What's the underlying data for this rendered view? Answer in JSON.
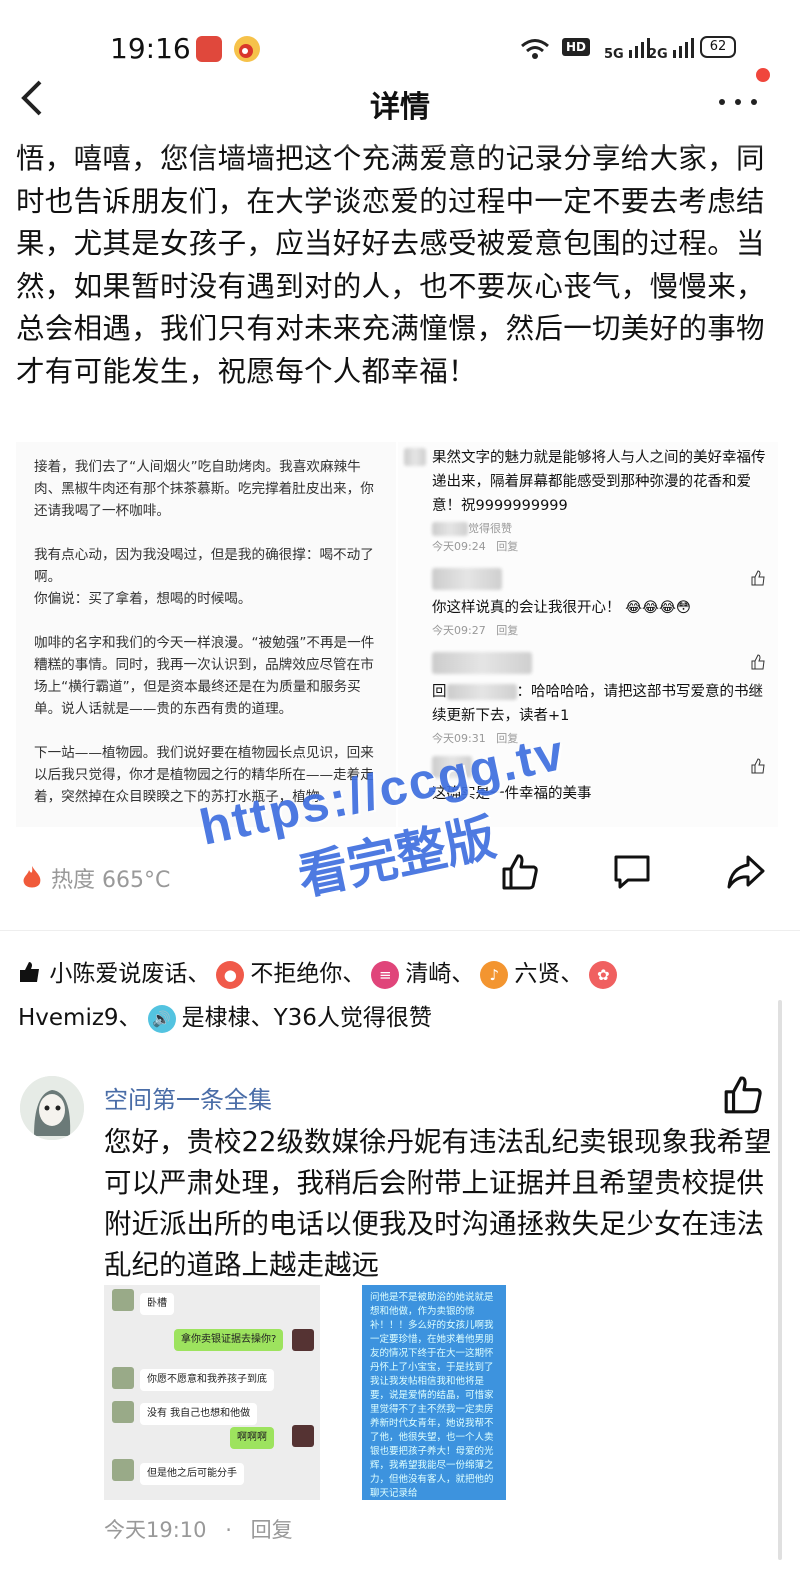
{
  "status_bar": {
    "time": "19:16",
    "network_5g": "5G",
    "network_2g": "2G",
    "battery": "62"
  },
  "header": {
    "title": "详情"
  },
  "post": {
    "text": "悟，嘻嘻，您信墙墙把这个充满爱意的记录分享给大家，同时也告诉朋友们，在大学谈恋爱的过程中一定不要去考虑结果，尤其是女孩子，应当好好去感受被爱意包围的过程。当然，如果暂时没有遇到对的人，也不要灰心丧气，慢慢来，总会相遇，我们只有对未来充满憧憬，然后一切美好的事物才有可能发生，祝愿每个人都幸福！",
    "image_left": {
      "p1": "接着，我们去了“人间烟火”吃自助烤肉。我喜欢麻辣牛肉、黑椒牛肉还有那个抹茶慕斯。吃完撑着肚皮出来，你还请我喝了一杯咖啡。",
      "p2": "我有点心动，因为我没喝过，但是我的确很撑：喝不动了啊。",
      "p3": "你偏说：买了拿着，想喝的时候喝。",
      "p4": "咖啡的名字和我们的今天一样浪漫。“被勉强”不再是一件糟糕的事情。同时，我再一次认识到，品牌效应尽管在市场上“横行霸道”，但是资本最终还是在为质量和服务买单。说人话就是——贵的东西有贵的道理。",
      "p5": "下一站——植物园。我们说好要在植物园长点见识，回来以后我只觉得，你才是植物园之行的精华所在——走着走着，突然掉在众目睽睽之下的苏打水瓶子，植物"
    },
    "image_right": {
      "comments": [
        {
          "text": "果然文字的魅力就是能够将人与人之间的美好幸福传递出来，隔着屏幕都能感受到那种弥漫的花香和爱意！祝9999999999",
          "sub": "觉得很赞",
          "meta": "今天09:24",
          "reply": "回复"
        },
        {
          "text": "你这样说真的会让我很开心！",
          "meta": "今天09:27",
          "reply": "回复"
        },
        {
          "prefix": "回",
          "text": "：哈哈哈哈，请把这部书写爱意的书继续更新下去，读者+1",
          "meta": "今天09:31",
          "reply": "回复"
        },
        {
          "text": "这确实是一件幸福的美事"
        }
      ]
    }
  },
  "actions": {
    "heat": "热度 665°C"
  },
  "watermark": {
    "line1": "https://ccgg.tv",
    "line2": "看完整版"
  },
  "likes": {
    "u1": "小陈爱说废话、",
    "u2": "不拒绝你、",
    "u3": "清崎、",
    "u4": "六贤、",
    "u5": "Hvemiz9、",
    "u6": "是棣棣、Y36人觉得很赞"
  },
  "comment": {
    "author": "空间第一条全集",
    "text": "您好，贵校22级数媒徐丹妮有违法乱纪卖银现象我希望可以严肃处理，我稍后会附带上证据并且希望贵校提供附近派出所的电话以便我及时沟通拯救失足少女在违法乱纪的道路上越走越远",
    "chat1": {
      "b1": "卧槽",
      "b2": "拿你卖银证据去操你?",
      "b3": "你愿不愿意和我养孩子到底",
      "b4": "没有 我自己也想和他做",
      "b5": "啊啊啊",
      "b6": "但是他之后可能分手"
    },
    "chat2_text": "问他是不是被助浴的她说就是想和他做，作为卖银的惊补！！！多么好的女孩儿啊我一定要珍惜，在她求着他男朋友的情况下终于在大一这期怀丹怀上了小宝宝，于是找到了我让我发帖相信我和他将是要，说是爱情的结晶，可惜家里觉得不了主不然我一定卖房养新时代女青年，她说我帮不了他，他很失望，也一个人卖银也要把孩子养大！母爱的光辉，我希望我能尽一份绵薄之力，但他没有客人，就把他的聊天记录给",
    "time": "今天19:10",
    "dot": "·",
    "reply": "回复"
  }
}
